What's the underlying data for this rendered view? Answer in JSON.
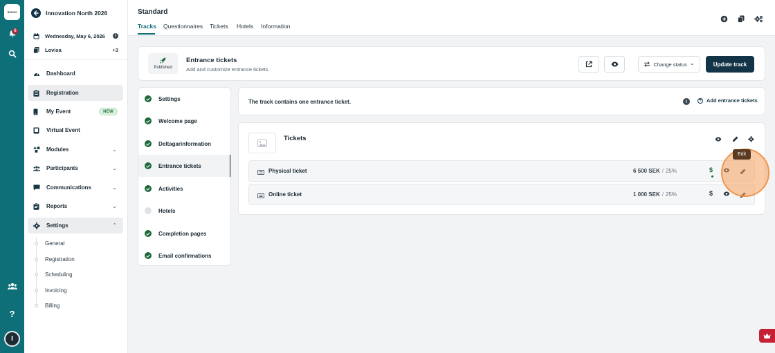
{
  "rail": {
    "logo_text": "INVIUO",
    "notification_count": "6",
    "avatar_initial": "I"
  },
  "sidebar": {
    "event_name": "Innovation North 2026",
    "date": "Wednesday, May 6, 2026",
    "user": "Lovisa",
    "user_extra": "+3",
    "items": [
      {
        "label": "Dashboard"
      },
      {
        "label": "Registration"
      },
      {
        "label": "My Event",
        "badge": "NEW"
      },
      {
        "label": "Virtual Event"
      },
      {
        "label": "Modules"
      },
      {
        "label": "Participants"
      },
      {
        "label": "Communications"
      },
      {
        "label": "Reports"
      },
      {
        "label": "Settings"
      }
    ],
    "settings_sub": [
      "General",
      "Registration",
      "Scheduling",
      "Invoicing",
      "Billing"
    ]
  },
  "header": {
    "title": "Standard",
    "tabs": [
      "Tracks",
      "Questionnaires",
      "Tickets",
      "Hotels",
      "Information"
    ]
  },
  "track": {
    "status_label": "Published",
    "name": "Entrance tickets",
    "description": "Add and customize entrance tickets.",
    "change_status_label": "Change status",
    "update_label": "Update track"
  },
  "steps": [
    {
      "label": "Settings",
      "done": true
    },
    {
      "label": "Welcome page",
      "done": true
    },
    {
      "label": "Deltagarinformation",
      "done": true
    },
    {
      "label": "Entrance tickets",
      "done": true
    },
    {
      "label": "Activities",
      "done": true
    },
    {
      "label": "Hotels",
      "done": false
    },
    {
      "label": "Completion pages",
      "done": true
    },
    {
      "label": "Email confirmations",
      "done": true
    }
  ],
  "info": {
    "text": "The track contains one entrance ticket.",
    "add_label": "Add entrance tickets"
  },
  "tickets_group": {
    "title": "Tickets",
    "tooltip": "Edit",
    "rows": [
      {
        "name": "Physical ticket",
        "price": "6 500 SEK",
        "sep": "/",
        "vat": "25%",
        "currency_symbol": "$",
        "currency_color": "#1e6a3a"
      },
      {
        "name": "Online ticket",
        "price": "1 000 SEK",
        "sep": "/",
        "vat": "25%",
        "currency_symbol": "$",
        "currency_color": "#1b2a33"
      }
    ]
  },
  "colors": {
    "brand_teal": "#0f6f79",
    "primary_dark": "#133447",
    "success_green": "#1e6a3a",
    "alert_red": "#c62033",
    "highlight_orange": "#f0954a"
  }
}
